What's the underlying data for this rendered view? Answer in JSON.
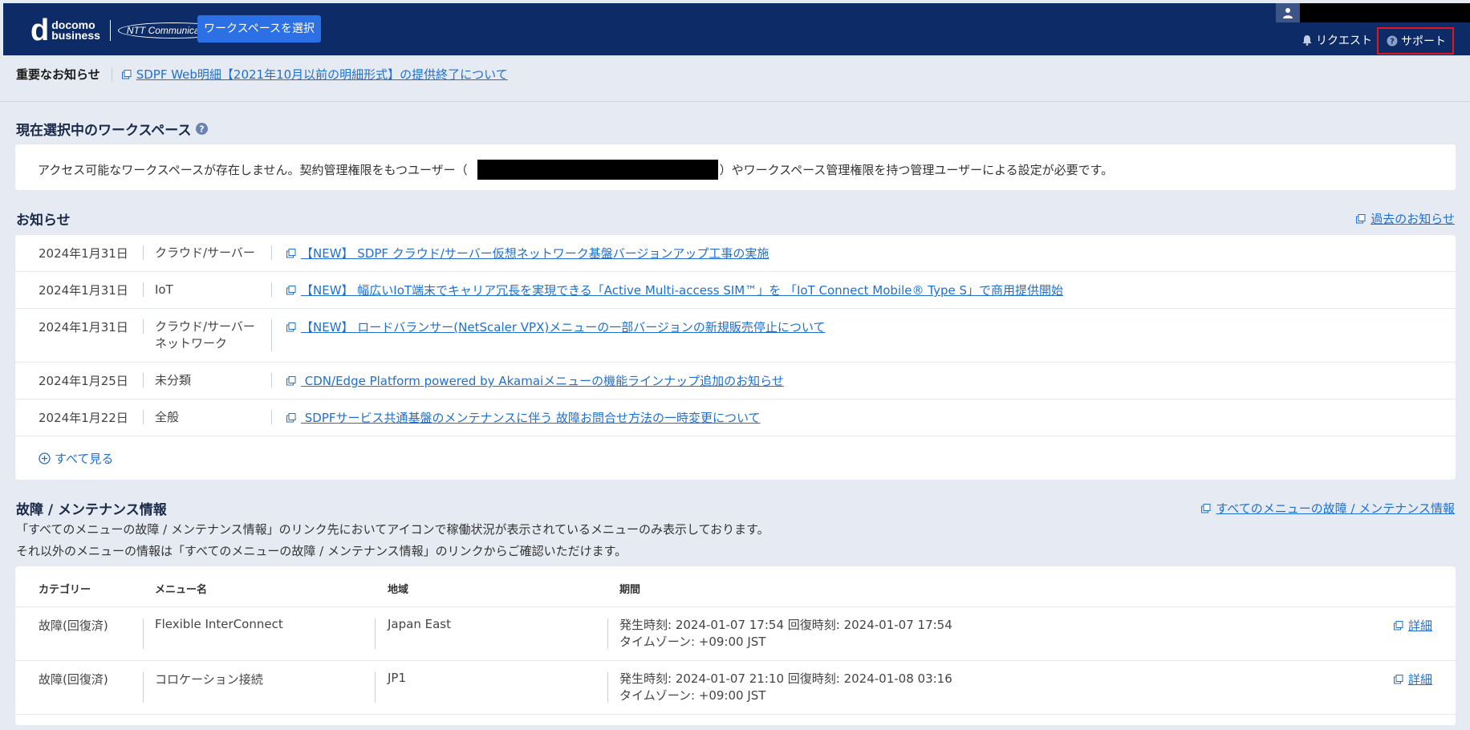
{
  "header": {
    "logo_brand": "d",
    "logo_text_line1": "docomo",
    "logo_text_line2": "business",
    "logo_ntt": "NTT Communications",
    "workspace_button": "ワークスペースを選択",
    "request_label": "リクエスト",
    "support_label": "サポート",
    "colors": {
      "bar": "#0d2b66",
      "button": "#2c70e6",
      "highlight": "#e8141b"
    }
  },
  "important_notice": {
    "title": "重要なお知らせ",
    "link": "SDPF Web明細【2021年10月以前の明細形式】の提供終了について"
  },
  "workspace": {
    "title": "現在選択中のワークスペース",
    "message_before": "アクセス可能なワークスペースが存在しません。契約管理権限をもつユーザー（",
    "message_after": "）やワークスペース管理権限を持つ管理ユーザーによる設定が必要です。"
  },
  "news": {
    "title": "お知らせ",
    "past_link": "過去のお知らせ",
    "see_all": "すべて見る",
    "items": [
      {
        "date": "2024年1月31日",
        "category": "クラウド/サーバー",
        "category2": "",
        "title": "【NEW】 SDPF クラウド/サーバー仮想ネットワーク基盤バージョンアップ工事の実施"
      },
      {
        "date": "2024年1月31日",
        "category": "IoT",
        "category2": "",
        "title": "【NEW】 幅広いIoT端末でキャリア冗長を実現できる「Active Multi-access SIM™」を 「IoT Connect Mobile® Type S」で商用提供開始"
      },
      {
        "date": "2024年1月31日",
        "category": "クラウド/サーバー",
        "category2": "ネットワーク",
        "title": "【NEW】 ロードバランサー(NetScaler VPX)メニューの一部バージョンの新規販売停止について"
      },
      {
        "date": "2024年1月25日",
        "category": "未分類",
        "category2": "",
        "title": " CDN/Edge Platform powered by Akamaiメニューの機能ラインナップ追加のお知らせ"
      },
      {
        "date": "2024年1月22日",
        "category": "全般",
        "category2": "",
        "title": " SDPFサービス共通基盤のメンテナンスに伴う 故障お問合せ方法の一時変更について"
      }
    ]
  },
  "maintenance": {
    "title": "故障 / メンテナンス情報",
    "all_link": "すべてのメニューの故障 / メンテナンス情報",
    "desc1": "「すべてのメニューの故障 / メンテナンス情報」のリンク先においてアイコンで稼働状況が表示されているメニューのみ表示しております。",
    "desc2": "それ以外のメニューの情報は「すべてのメニューの故障 / メンテナンス情報」のリンクからご確認いただけます。",
    "columns": [
      "カテゴリー",
      "メニュー名",
      "地域",
      "期間"
    ],
    "rows": [
      {
        "category": "故障(回復済)",
        "menu": "Flexible InterConnect",
        "region": "Japan East",
        "period1": "発生時刻: 2024-01-07 17:54 回復時刻: 2024-01-07 17:54",
        "period2": "タイムゾーン: +09:00 JST",
        "detail": "詳細"
      },
      {
        "category": "故障(回復済)",
        "menu": "コロケーション接続",
        "region": "JP1",
        "period1": "発生時刻: 2024-01-07 21:10 回復時刻: 2024-01-08 03:16",
        "period2": "タイムゾーン: +09:00 JST",
        "detail": "詳細"
      }
    ]
  }
}
